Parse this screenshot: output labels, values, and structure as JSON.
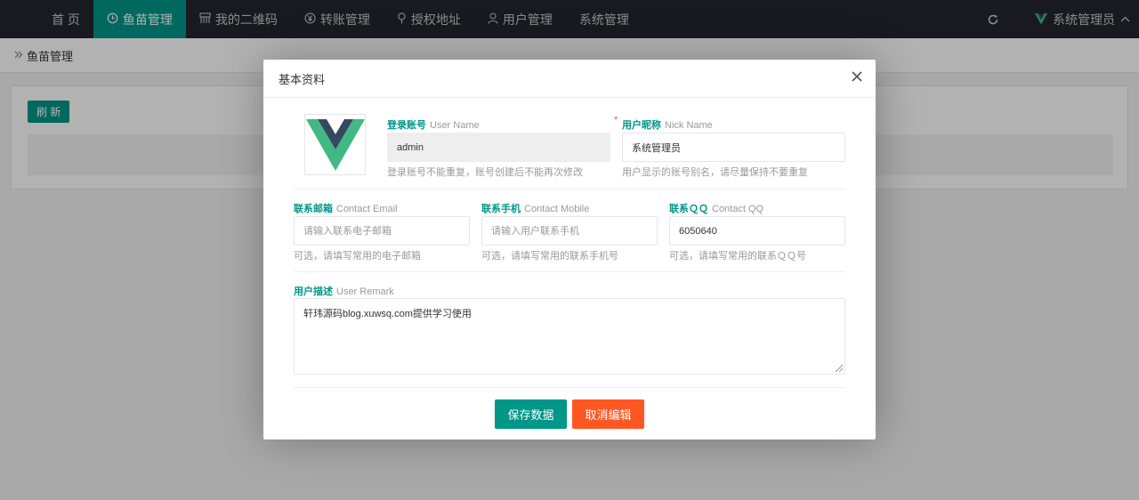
{
  "nav": {
    "items": [
      {
        "label": "首 页",
        "icon": ""
      },
      {
        "label": "鱼苗管理",
        "icon": "clock-icon"
      },
      {
        "label": "我的二维码",
        "icon": "qrcode-icon"
      },
      {
        "label": "转账管理",
        "icon": "yen-icon"
      },
      {
        "label": "授权地址",
        "icon": "location-icon"
      },
      {
        "label": "用户管理",
        "icon": "user-icon"
      },
      {
        "label": "系统管理",
        "icon": ""
      }
    ],
    "user": "系统管理员"
  },
  "breadcrumb": "鱼苗管理",
  "card": {
    "refresh_label": "刷 新"
  },
  "modal": {
    "title": "基本资料",
    "username": {
      "label_cn": "登录账号",
      "label_en": "User Name",
      "value": "admin",
      "hint": "登录账号不能重复，账号创建后不能再次修改"
    },
    "nickname": {
      "required": "*",
      "label_cn": "用户昵称",
      "label_en": "Nick Name",
      "value": "系统管理员",
      "hint": "用户显示的账号别名，请尽量保持不要重复"
    },
    "email": {
      "label_cn": "联系邮箱",
      "label_en": "Contact Email",
      "placeholder": "请输入联系电子邮箱",
      "hint": "可选，请填写常用的电子邮箱"
    },
    "mobile": {
      "label_cn": "联系手机",
      "label_en": "Contact Mobile",
      "placeholder": "请输入用户联系手机",
      "hint": "可选，请填写常用的联系手机号"
    },
    "qq": {
      "label_cn": "联系ＱＱ",
      "label_en": "Contact QQ",
      "value": "6050640",
      "hint": "可选，请填写常用的联系ＱＱ号"
    },
    "remark": {
      "label_cn": "用户描述",
      "label_en": "User Remark",
      "value": "轩玮源码blog.xuwsq.com提供学习使用"
    },
    "save_label": "保存数据",
    "cancel_label": "取消编辑"
  },
  "colors": {
    "nav_bg": "#23262e",
    "accent": "#009688",
    "danger": "#ff5722"
  }
}
